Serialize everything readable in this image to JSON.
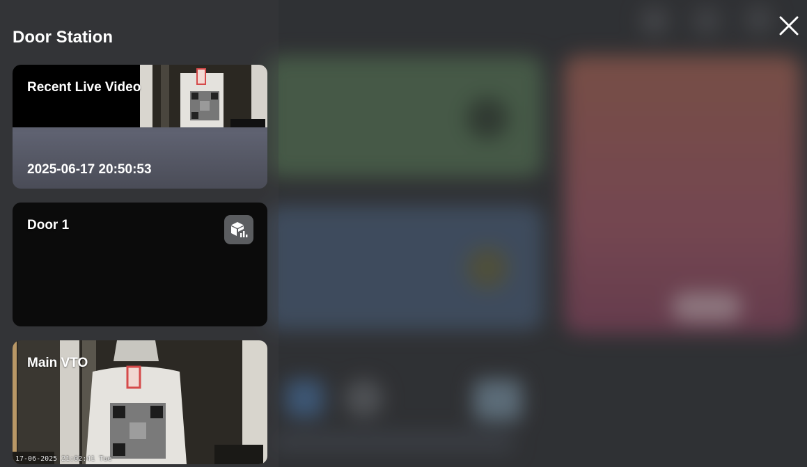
{
  "panel": {
    "title": "Door Station",
    "close_icon": "close-icon"
  },
  "devices": [
    {
      "label": "Recent Live Video",
      "timestamp": "2025-06-17 20:50:53"
    },
    {
      "label": "Door 1",
      "icon": "cube-chart-icon"
    },
    {
      "label": "Main VTO",
      "osd_stamp": "17-06-2025 21:02:41 Tue"
    }
  ]
}
